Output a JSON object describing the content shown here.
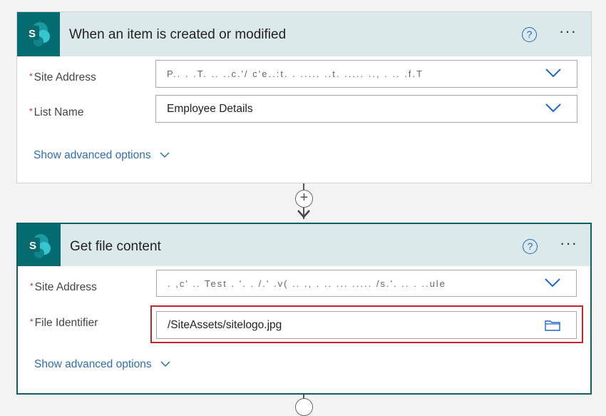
{
  "trigger": {
    "title": "When an item is created or modified",
    "help_icon": "?",
    "more": "···",
    "fields": [
      {
        "label": "Site Address",
        "value": "P.. . .T. .. ..c.'/ c'e..:t. . ..... ..t. ..... .., . .. .f.T"
      },
      {
        "label": "List Name",
        "value": "Employee Details"
      }
    ],
    "advanced": "Show advanced options"
  },
  "add_step": "+",
  "action": {
    "title": "Get file content",
    "help_icon": "?",
    "more": "···",
    "fields": [
      {
        "label": "Site Address",
        "value": ". ,c' .. Test . '. . /.' .v( .. ., . .. ... ..... /s.'. .. . ..ule"
      },
      {
        "label": "File Identifier",
        "value": "/SiteAssets/sitelogo.jpg"
      }
    ],
    "advanced": "Show advanced options"
  },
  "required_mark": "*",
  "colors": {
    "brand": "#036c70",
    "link": "#2f6db5",
    "required": "#c4262e"
  }
}
